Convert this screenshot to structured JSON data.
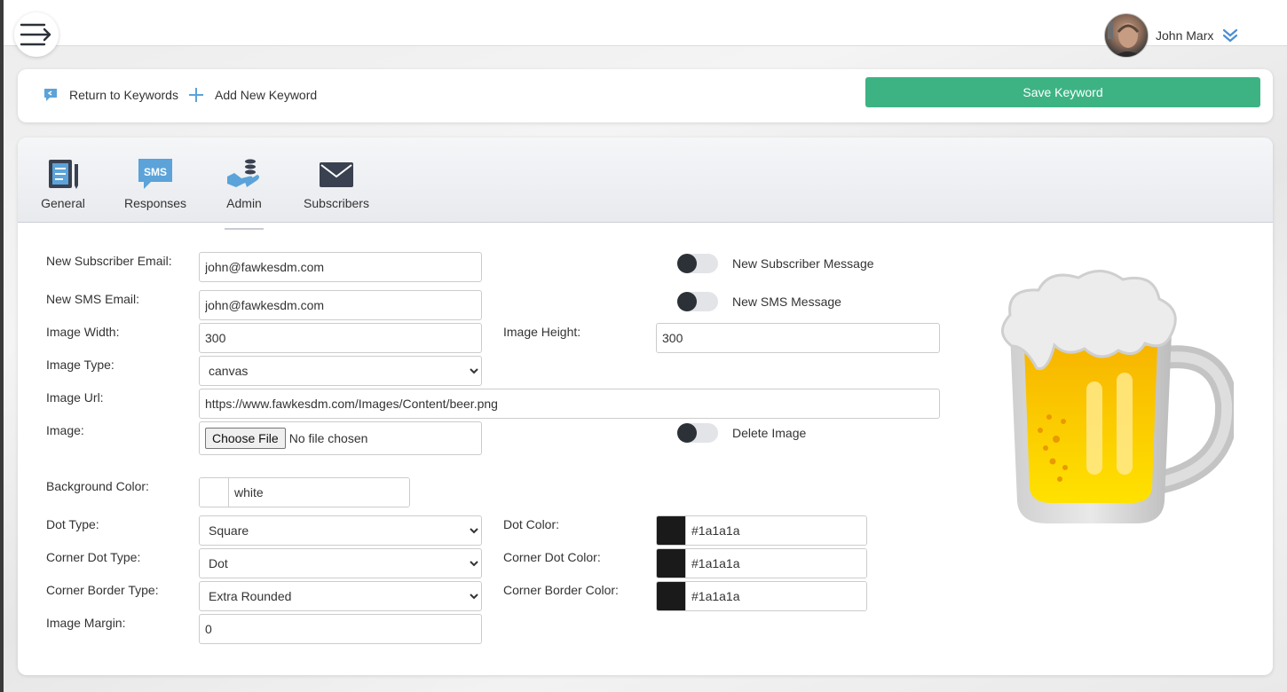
{
  "header": {
    "user_name": "John Marx"
  },
  "actions": {
    "return_label": "Return to Keywords",
    "add_label": "Add New Keyword",
    "save_label": "Save Keyword"
  },
  "tabs": [
    {
      "label": "General",
      "icon": "notebook-icon"
    },
    {
      "label": "Responses",
      "icon": "sms-icon"
    },
    {
      "label": "Admin",
      "icon": "hand-coins-icon"
    },
    {
      "label": "Subscribers",
      "icon": "envelope-icon"
    }
  ],
  "form": {
    "new_subscriber_email": {
      "label": "New Subscriber Email:",
      "value": "john@fawkesdm.com"
    },
    "new_sms_email": {
      "label": "New SMS Email:",
      "value": "john@fawkesdm.com"
    },
    "image_width": {
      "label": "Image Width:",
      "value": "300"
    },
    "image_height": {
      "label": "Image Height:",
      "value": "300"
    },
    "image_type": {
      "label": "Image Type:",
      "value": "canvas"
    },
    "image_url": {
      "label": "Image Url:",
      "value": "https://www.fawkesdm.com/Images/Content/beer.png"
    },
    "image": {
      "label": "Image:",
      "button": "Choose File",
      "status": "No file chosen"
    },
    "background_color": {
      "label": "Background Color:",
      "value": "white",
      "swatch": "#ffffff"
    },
    "dot_type": {
      "label": "Dot Type:",
      "value": "Square"
    },
    "dot_color": {
      "label": "Dot Color:",
      "value": "#1a1a1a",
      "swatch": "#1a1a1a"
    },
    "corner_dot_type": {
      "label": "Corner Dot Type:",
      "value": "Dot"
    },
    "corner_dot_color": {
      "label": "Corner Dot Color:",
      "value": "#1a1a1a",
      "swatch": "#1a1a1a"
    },
    "corner_border_type": {
      "label": "Corner Border Type:",
      "value": "Extra Rounded"
    },
    "corner_border_color": {
      "label": "Corner Border Color:",
      "value": "#1a1a1a",
      "swatch": "#1a1a1a"
    },
    "image_margin": {
      "label": "Image Margin:",
      "value": "0"
    }
  },
  "toggles": {
    "new_subscriber_message": {
      "label": "New Subscriber Message",
      "on": false
    },
    "new_sms_message": {
      "label": "New SMS Message",
      "on": false
    },
    "delete_image": {
      "label": "Delete Image",
      "on": false
    }
  },
  "colors": {
    "accent_green": "#3db383",
    "icon_blue": "#5ba3d9",
    "icon_dark": "#3a4150"
  }
}
